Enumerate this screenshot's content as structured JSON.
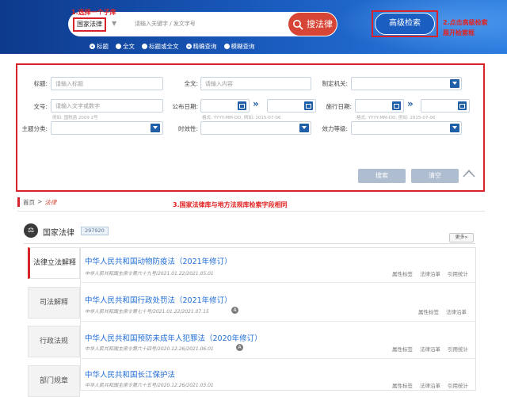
{
  "header": {
    "db_select": "国家法律",
    "search_placeholder": "请输入关键字 / 发文字号",
    "search_button": "搜法律",
    "advanced_button": "高级检索",
    "annotation_1": "1.选择一个子库",
    "annotation_2_line1": "2.点击高级检索",
    "annotation_2_line2": "展开检索框",
    "radio_options": [
      "标题",
      "全文",
      "标题或全文",
      "精确查询",
      "模糊查询"
    ],
    "radio_selected": [
      "标题",
      "精确查询"
    ]
  },
  "panel": {
    "title_label": "标题:",
    "title_placeholder": "请输入标题",
    "fulltext_label": "全文:",
    "fulltext_placeholder": "请输入内容",
    "agency_label": "制定机关:",
    "docno_label": "文号:",
    "docno_placeholder": "请输入文字或数字",
    "docno_hint": "例如: 国税函 2009 2号",
    "pubdate_label": "公布日期:",
    "effdate_label": "施行日期:",
    "date_hint": "格式: YYYY-MM-DD, 例如: 2015-07-06",
    "topic_label": "主题分类:",
    "validity_label": "时效性:",
    "level_label": "效力等级:",
    "search_button": "搜索",
    "clear_button": "清空"
  },
  "breadcrumb": {
    "home": "首页",
    "sep": ">",
    "current": "法律"
  },
  "annotation_3": "3.国家法律库与地方法规库检索字段相同",
  "section": {
    "icon": "scale-icon",
    "title": "国家法律",
    "count": "297920",
    "more": "更多»"
  },
  "tabs": [
    "法律立法解释",
    "司法解释",
    "行政法规",
    "部门规章"
  ],
  "results": [
    {
      "title": "中华人民共和国动物防疫法（2021年修订）",
      "sub": "中华人民共和国主席令第六十九号/2021.01.22/2021.05.01",
      "tags": [
        "属性标签",
        "法律沿革",
        "引用统计"
      ],
      "icon": false
    },
    {
      "title": "中华人民共和国行政处罚法（2021年修订）",
      "sub": "中华人民共和国主席令第七十号/2021.01.22/2021.07.15",
      "tags": [
        "属性标签",
        "法律沿革"
      ],
      "icon": true
    },
    {
      "title": "中华人民共和国预防未成年人犯罪法（2020年修订）",
      "sub": "中华人民共和国主席令第六十四号/2020.12.26/2021.06.01",
      "tags": [
        "属性标签",
        "法律沿革",
        "引用统计"
      ],
      "icon": true
    },
    {
      "title": "中华人民共和国长江保护法",
      "sub": "中华人民共和国主席令第六十五号/2020.12.26/2021.03.01",
      "tags": [
        "属性标签",
        "法律沿革",
        "引用统计"
      ],
      "icon": false
    }
  ],
  "colors": {
    "header_blue": "#1a5cc0",
    "accent_red": "#d64535",
    "link_blue": "#1e6cd6",
    "annotation_red": "#e32222"
  }
}
